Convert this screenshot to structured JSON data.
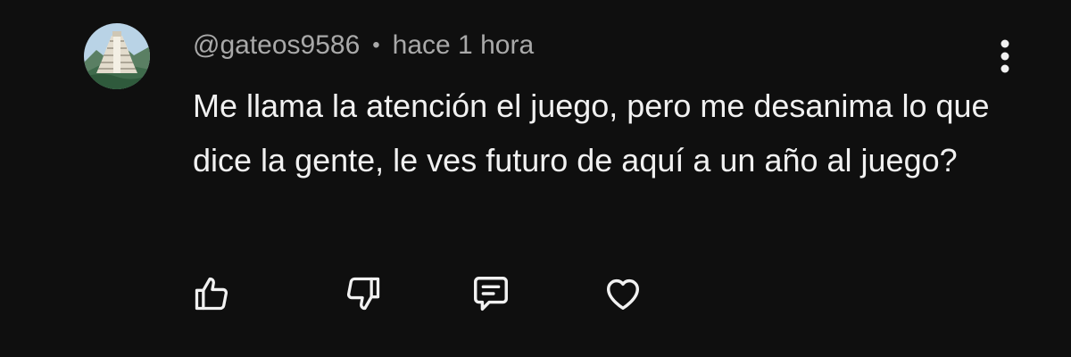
{
  "comment": {
    "author": "@gateos9586",
    "separator": "•",
    "timestamp": "hace 1 hora",
    "text": "Me llama la atención el juego, pero me desanima lo que dice la gente, le ves futuro de aquí a un año al juego?",
    "avatar_icon": "pyramid-landscape-avatar"
  },
  "actions": {
    "like_icon": "thumbs-up-icon",
    "dislike_icon": "thumbs-down-icon",
    "reply_icon": "comment-reply-icon",
    "heart_icon": "heart-icon",
    "menu_icon": "more-vertical-icon"
  },
  "colors": {
    "background": "#0f0f0f",
    "primary_text": "#f1f1f1",
    "secondary_text": "#a9a9a9"
  }
}
